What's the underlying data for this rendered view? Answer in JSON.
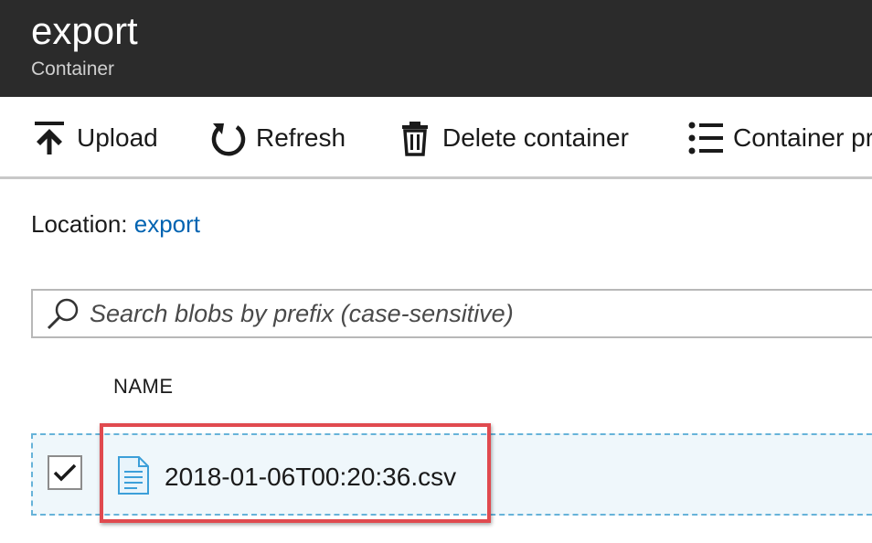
{
  "header": {
    "title": "export",
    "subtitle": "Container",
    "background_color": "#2b2b2b"
  },
  "toolbar": {
    "buttons": [
      {
        "label": "Upload",
        "icon": "upload-icon"
      },
      {
        "label": "Refresh",
        "icon": "refresh-icon"
      },
      {
        "label": "Delete container",
        "icon": "trash-icon"
      },
      {
        "label": "Container properties",
        "icon": "list-icon"
      }
    ]
  },
  "location": {
    "label": "Location:",
    "value": "export"
  },
  "search": {
    "placeholder": "Search blobs by prefix (case-sensitive)",
    "value": ""
  },
  "table": {
    "columns": [
      "NAME"
    ],
    "rows": [
      {
        "name": "2018-01-06T00:20:36.csv",
        "selected": true,
        "icon": "document-icon"
      }
    ]
  },
  "colors": {
    "link": "#0063b1",
    "row_selected_bg": "#eff7fb",
    "row_selected_border": "#67b3d9",
    "highlight_annotation": "#e04a4f"
  }
}
